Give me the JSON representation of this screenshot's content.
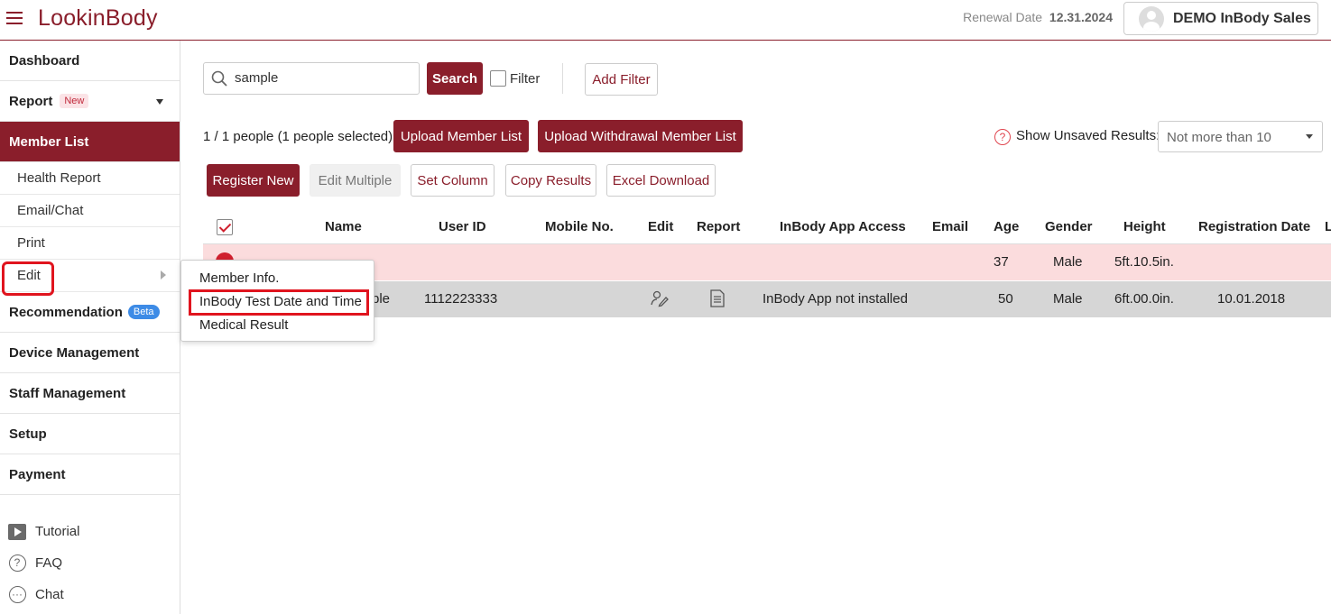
{
  "header": {
    "app_title": "LookinBody",
    "renewal_label": "Renewal Date",
    "renewal_date": "12.31.2024",
    "user_name": "DEMO InBody Sales"
  },
  "sidebar": {
    "items": [
      {
        "label": "Dashboard"
      },
      {
        "label": "Report",
        "badge": "New"
      },
      {
        "label": "Member List"
      },
      {
        "label": "Health Report"
      },
      {
        "label": "Email/Chat"
      },
      {
        "label": "Print"
      },
      {
        "label": "Edit"
      },
      {
        "label": "Recommendation",
        "badge": "Beta"
      },
      {
        "label": "Device Management"
      },
      {
        "label": "Staff Management"
      },
      {
        "label": "Setup"
      },
      {
        "label": "Payment"
      }
    ],
    "bottom_links": [
      {
        "label": "Tutorial",
        "icon": "play-icon"
      },
      {
        "label": "FAQ",
        "icon": "help-icon"
      },
      {
        "label": "Chat",
        "icon": "chat-icon"
      }
    ]
  },
  "toolbar": {
    "search_value": "sample",
    "search_label": "Search",
    "filter_label": "Filter",
    "add_filter_label": "Add Filter",
    "people_count": "1 / 1 people (1 people selected)",
    "upload_member_label": "Upload Member List",
    "upload_withdrawal_label": "Upload Withdrawal Member List",
    "unsaved_label": "Show Unsaved Results:",
    "unsaved_value": "Not more than 10",
    "register_new_label": "Register New",
    "edit_multiple_label": "Edit Multiple",
    "set_column_label": "Set Column",
    "copy_results_label": "Copy Results",
    "excel_download_label": "Excel Download"
  },
  "table": {
    "columns": [
      "Name",
      "User ID",
      "Mobile No.",
      "Edit",
      "Report",
      "InBody App Access",
      "Email",
      "Age",
      "Gender",
      "Height",
      "Registration Date",
      "L"
    ],
    "rows": [
      {
        "name": "",
        "user_id": "",
        "mobile": "",
        "app_access": "",
        "email": "",
        "age": "37",
        "gender": "Male",
        "height": "5ft.10.5in.",
        "registration_date": ""
      },
      {
        "name": "ple",
        "user_id": "1112223333",
        "mobile": "",
        "app_access": "InBody App not installed",
        "email": "",
        "age": "50",
        "gender": "Male",
        "height": "6ft.00.0in.",
        "registration_date": "10.01.2018"
      }
    ]
  },
  "edit_menu": {
    "items": [
      "Member Info.",
      "InBody Test Date and Time",
      "Medical Result"
    ]
  },
  "colors": {
    "brand": "#8a1e2b",
    "highlight": "#e0141e",
    "warning_row": "#fbdcdd",
    "selected_row": "#d6d6d6"
  }
}
